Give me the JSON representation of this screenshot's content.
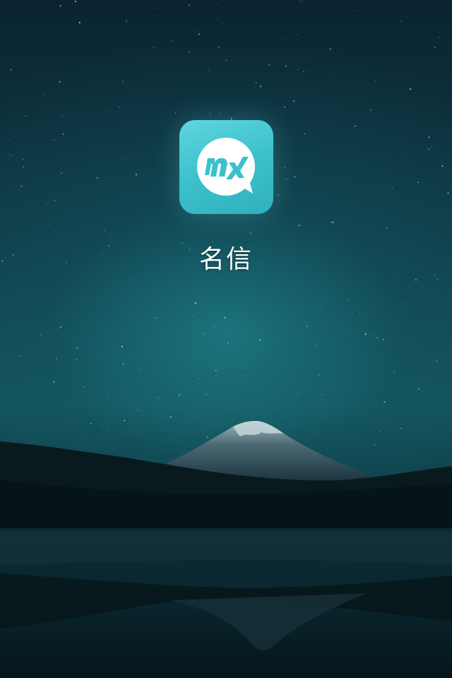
{
  "app": {
    "name": "名信",
    "icon_name": "mx-chat-bubble-icon",
    "icon_colors": {
      "background": "#3cc1cc",
      "bubble": "#ffffff",
      "glyph": "#3cc1cc"
    }
  },
  "wallpaper": {
    "scene": "night-sky-mountain-lake",
    "sky_color": "#0f3a45",
    "glow_color": "#2a9aa5",
    "ground_color": "#061a20"
  }
}
